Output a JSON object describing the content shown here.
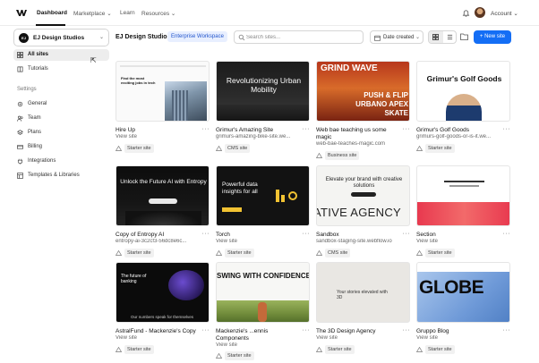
{
  "nav": {
    "items": [
      "Dashboard",
      "Marketplace",
      "Learn",
      "Resources"
    ],
    "account_label": "Account"
  },
  "sidebar": {
    "workspace_icon_text": "EJ",
    "workspace_name": "EJ Design Studios",
    "items": [
      "All sites",
      "Tutorials"
    ],
    "settings_heading": "Settings",
    "settings_items": [
      "General",
      "Team",
      "Plans",
      "Billing",
      "Integrations",
      "Templates & Libraries"
    ]
  },
  "header": {
    "title": "EJ Design Studios",
    "badge": "Enterprise Workspace",
    "search_placeholder": "Search sites...",
    "sort_label": "Date created",
    "new_site_label": "+ New site"
  },
  "sites": [
    {
      "name": "Hire Up",
      "url": "View site",
      "tag": "Starter site",
      "thumb_title": "Find the most exciting jobs in tech"
    },
    {
      "name": "Grimur's Amazing Site",
      "url": "grimurs-amazing-bike-site.we...",
      "tag": "CMS site",
      "thumb_title": "Revolutionizing Urban Mobility"
    },
    {
      "name": "Web bae teaching us some magic",
      "url": "web-bae-teaches-magic.com",
      "tag": "Business site",
      "thumb_title": "GRIND WAVE",
      "thumb_sub": "PUSH & FLIP URBANO APEX SKATE"
    },
    {
      "name": "Grimur's Golf Goods",
      "url": "grimurs-golf-goods-or-is-it.we...",
      "tag": "Starter site",
      "thumb_title": "Grimur's Golf Goods"
    },
    {
      "name": "Copy of Entropy AI",
      "url": "entropy-ai-3c2cf3-56dc8e6c...",
      "tag": "Starter site",
      "thumb_title": "Unlock the Future AI with Entropy"
    },
    {
      "name": "Torch",
      "url": "View site",
      "tag": "Starter site",
      "thumb_title": "Powerful data insights for all"
    },
    {
      "name": "Sandbox",
      "url": "sandbox-staging-site.webflow.io",
      "tag": "CMS site",
      "thumb_title": "Elevate your brand with creative solutions",
      "thumb_sub": "ATIVE AGENCY"
    },
    {
      "name": "Section",
      "url": "View site",
      "tag": "Starter site",
      "thumb_title": ""
    },
    {
      "name": "AstralFund - Mackenzie's Copy",
      "url": "View site",
      "tag": "Starter site",
      "thumb_title": "The future of banking",
      "thumb_sub": "Our numbers speak for themselves"
    },
    {
      "name": "Mackenzie's ...ennis Components",
      "url": "View site",
      "tag": "Starter site",
      "thumb_title": "SWING WITH CONFIDENCE"
    },
    {
      "name": "The 3D Design Agency",
      "url": "View site",
      "tag": "Starter site",
      "thumb_title": "Your stories elevated with 3D"
    },
    {
      "name": "Gruppo Blog",
      "url": "View site",
      "tag": "Starter site",
      "thumb_title": "GLOBE"
    }
  ],
  "colors": {
    "accent": "#146ef5",
    "badge_bg": "#e8efff",
    "badge_text": "#2255cc"
  }
}
